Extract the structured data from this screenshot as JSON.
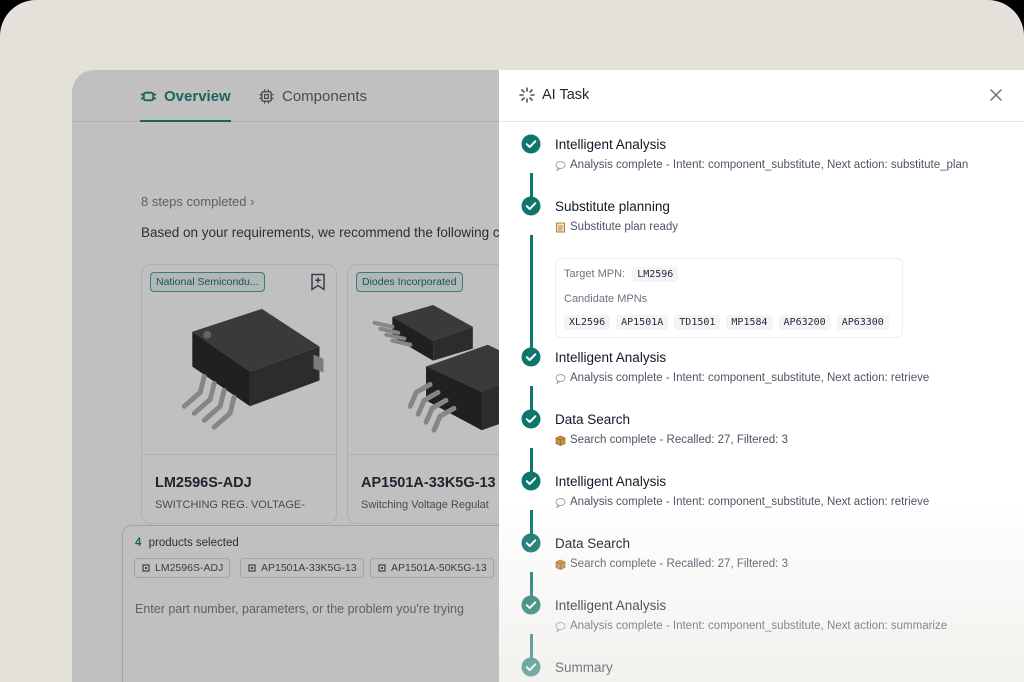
{
  "tabs": {
    "overview": "Overview",
    "components": "Components"
  },
  "main": {
    "steps": "8 steps completed ›",
    "recommend": "Based on your requirements, we recommend the following c"
  },
  "cards": [
    {
      "badge": "National Semicondu...",
      "mpn": "LM2596S-ADJ",
      "desc": "SWITCHING REG. VOLTAGE-"
    },
    {
      "badge": "Diodes Incorporated",
      "mpn": "AP1501A-33K5G-13",
      "desc": "Switching Voltage Regulat"
    }
  ],
  "composer": {
    "count": "4",
    "selected_label": "products selected",
    "chips": [
      "LM2596S-ADJ",
      "AP1501A-33K5G-13",
      "AP1501A-50K5G-13"
    ],
    "placeholder": "Enter part number, parameters, or the problem you're trying"
  },
  "panel": {
    "title": "AI Task",
    "items": [
      {
        "title": "Intelligent Analysis",
        "sub": "Analysis complete - Intent: component_substitute, Next action: substitute_plan",
        "icon": "speech-bubble-icon"
      },
      {
        "title": "Substitute planning",
        "sub": "Substitute plan ready",
        "icon": "notepad-icon"
      },
      {
        "title": "Intelligent Analysis",
        "sub": "Analysis complete - Intent: component_substitute, Next action: retrieve",
        "icon": "speech-bubble-icon"
      },
      {
        "title": "Data Search",
        "sub": "Search complete - Recalled: 27, Filtered: 3",
        "icon": "package-icon"
      },
      {
        "title": "Intelligent Analysis",
        "sub": "Analysis complete - Intent: component_substitute, Next action: retrieve",
        "icon": "speech-bubble-icon"
      },
      {
        "title": "Data Search",
        "sub": "Search complete - Recalled: 27, Filtered: 3",
        "icon": "package-icon"
      },
      {
        "title": "Intelligent Analysis",
        "sub": "Analysis complete - Intent: component_substitute, Next action: summarize",
        "icon": "speech-bubble-icon"
      },
      {
        "title": "Summary",
        "sub": "",
        "icon": ""
      }
    ],
    "plan": {
      "target_label": "Target MPN:",
      "target_value": "LM2596",
      "candidates_label": "Candidate MPNs",
      "candidates": [
        "XL2596",
        "AP1501A",
        "TD1501",
        "MP1584",
        "AP63200",
        "AP63300"
      ]
    }
  },
  "colors": {
    "accent": "#0f766e",
    "badge_bg": "#e6f3f1"
  }
}
